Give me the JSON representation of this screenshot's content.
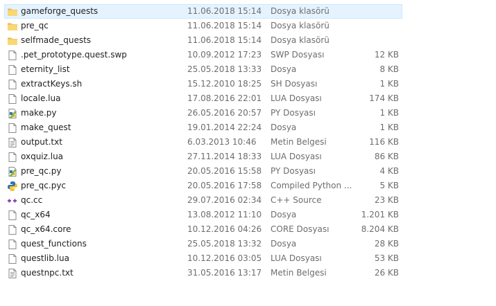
{
  "files": [
    {
      "name": "gameforge_quests",
      "date": "11.06.2018 15:14",
      "type": "Dosya klasörü",
      "size": "",
      "icon": "folder-icon",
      "selected": true
    },
    {
      "name": "pre_qc",
      "date": "11.06.2018 15:14",
      "type": "Dosya klasörü",
      "size": "",
      "icon": "folder-icon"
    },
    {
      "name": "selfmade_quests",
      "date": "11.06.2018 15:14",
      "type": "Dosya klasörü",
      "size": "",
      "icon": "folder-icon"
    },
    {
      "name": ".pet_prototype.quest.swp",
      "date": "10.09.2012 17:23",
      "type": "SWP Dosyası",
      "size": "12 KB",
      "icon": "file-icon"
    },
    {
      "name": "eternity_list",
      "date": "25.05.2018 13:33",
      "type": "Dosya",
      "size": "8 KB",
      "icon": "file-icon"
    },
    {
      "name": "extractKeys.sh",
      "date": "15.12.2010 18:25",
      "type": "SH Dosyası",
      "size": "1 KB",
      "icon": "file-icon"
    },
    {
      "name": "locale.lua",
      "date": "17.08.2016 22:01",
      "type": "LUA Dosyası",
      "size": "174 KB",
      "icon": "file-icon"
    },
    {
      "name": "make.py",
      "date": "26.05.2016 20:57",
      "type": "PY Dosyası",
      "size": "1 KB",
      "icon": "python-script-icon"
    },
    {
      "name": "make_quest",
      "date": "19.01.2014 22:24",
      "type": "Dosya",
      "size": "1 KB",
      "icon": "file-icon"
    },
    {
      "name": "output.txt",
      "date": "6.03.2013 10:46",
      "type": "Metin Belgesi",
      "size": "116 KB",
      "icon": "text-file-icon"
    },
    {
      "name": "oxquiz.lua",
      "date": "27.11.2014 18:33",
      "type": "LUA Dosyası",
      "size": "86 KB",
      "icon": "file-icon"
    },
    {
      "name": "pre_qc.py",
      "date": "20.05.2016 15:58",
      "type": "PY Dosyası",
      "size": "4 KB",
      "icon": "python-script-icon"
    },
    {
      "name": "pre_qc.pyc",
      "date": "20.05.2016 17:58",
      "type": "Compiled Python ...",
      "size": "5 KB",
      "icon": "python-compiled-icon"
    },
    {
      "name": "qc.cc",
      "date": "29.07.2016 02:34",
      "type": "C++ Source",
      "size": "23 KB",
      "icon": "cpp-source-icon"
    },
    {
      "name": "qc_x64",
      "date": "13.08.2012 11:10",
      "type": "Dosya",
      "size": "1.201 KB",
      "icon": "file-icon"
    },
    {
      "name": "qc_x64.core",
      "date": "10.12.2016 04:26",
      "type": "CORE Dosyası",
      "size": "8.204 KB",
      "icon": "file-icon"
    },
    {
      "name": "quest_functions",
      "date": "25.05.2018 13:32",
      "type": "Dosya",
      "size": "28 KB",
      "icon": "file-icon"
    },
    {
      "name": "questlib.lua",
      "date": "10.12.2016 03:05",
      "type": "LUA Dosyası",
      "size": "53 KB",
      "icon": "file-icon"
    },
    {
      "name": "questnpc.txt",
      "date": "31.05.2016 13:17",
      "type": "Metin Belgesi",
      "size": "26 KB",
      "icon": "text-file-icon"
    }
  ],
  "colors": {
    "selection_bg": "#e5f3ff",
    "selection_border": "#cce8ff",
    "folder": "#f8d775",
    "secondary_text": "#6d6d6d"
  }
}
